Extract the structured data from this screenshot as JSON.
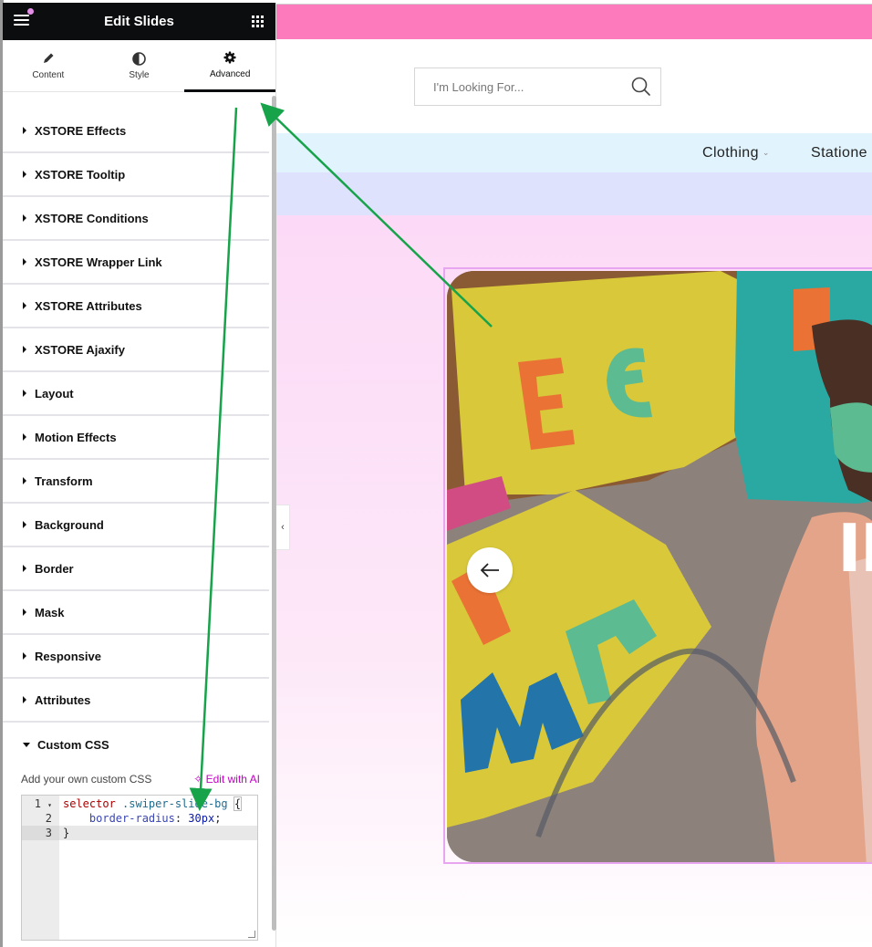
{
  "panel": {
    "title": "Edit Slides",
    "menu_icon": "hamburger-icon",
    "apps_icon": "grid-icon",
    "tabs": [
      {
        "label": "Content",
        "icon": "pencil-icon",
        "active": false
      },
      {
        "label": "Style",
        "icon": "half-circle-icon",
        "active": false
      },
      {
        "label": "Advanced",
        "icon": "gear-icon",
        "active": true
      }
    ],
    "sections": [
      {
        "label": "XSTORE Effects",
        "open": false
      },
      {
        "label": "XSTORE Tooltip",
        "open": false
      },
      {
        "label": "XSTORE Conditions",
        "open": false
      },
      {
        "label": "XSTORE Wrapper Link",
        "open": false
      },
      {
        "label": "XSTORE Attributes",
        "open": false
      },
      {
        "label": "XSTORE Ajaxify",
        "open": false
      },
      {
        "label": "Layout",
        "open": false
      },
      {
        "label": "Motion Effects",
        "open": false
      },
      {
        "label": "Transform",
        "open": false
      },
      {
        "label": "Background",
        "open": false
      },
      {
        "label": "Border",
        "open": false
      },
      {
        "label": "Mask",
        "open": false
      },
      {
        "label": "Responsive",
        "open": false
      },
      {
        "label": "Attributes",
        "open": false
      },
      {
        "label": "Custom CSS",
        "open": true
      }
    ],
    "custom_css": {
      "description": "Add your own custom CSS",
      "edit_ai_label": "Edit with AI",
      "edit_ai_icon": "sparkle-icon",
      "line_numbers": [
        "1",
        "2",
        "3"
      ],
      "lines": [
        {
          "selector": "selector",
          "class": ".swiper-slide-bg",
          "open_brace": "{"
        },
        {
          "property": "border-radius",
          "colon": ":",
          "value": "30px",
          "semicolon": ";"
        },
        {
          "close_brace": "}"
        }
      ],
      "active_line": 3
    },
    "collapse_icon": "chevron-left-icon"
  },
  "site": {
    "search": {
      "placeholder": "I'm Looking For...",
      "icon": "search-icon"
    },
    "nav": [
      {
        "label": "Clothing",
        "has_dropdown": true
      },
      {
        "label": "Statione",
        "has_dropdown": false
      }
    ],
    "slide": {
      "heading_partial": "IM",
      "prev_icon": "arrow-left-icon"
    }
  },
  "colors": {
    "topbar": "#fd7bbd",
    "nav_bg": "#e1f4fd",
    "band_violet": "#dfe2fd",
    "band_pink": "#fcdaf7",
    "annotation_arrow": "#17a34a",
    "ai_accent": "#c200c2"
  }
}
